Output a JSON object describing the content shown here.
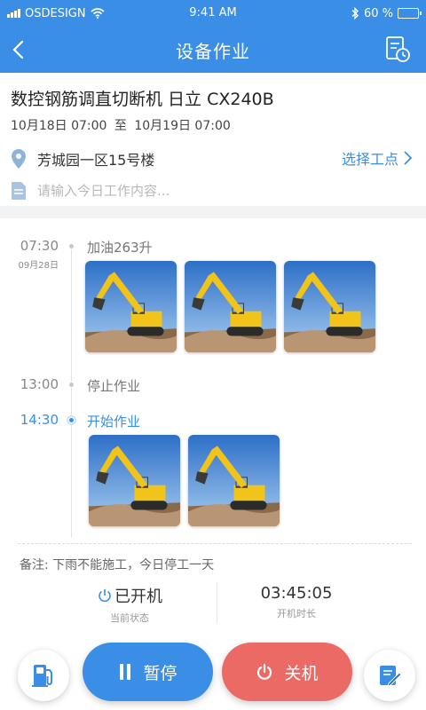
{
  "status_bar": {
    "carrier": "OSDESIGN",
    "time": "9:41 AM",
    "battery": "60 %",
    "battery_level": 0.6,
    "signal_icon": "signal-bars-icon",
    "wifi_icon": "wifi-icon",
    "bluetooth_icon": "bluetooth-icon"
  },
  "nav": {
    "title": "设备作业",
    "back_icon": "chevron-left-icon",
    "doc_icon": "document-clock-icon"
  },
  "equipment": {
    "name": "数控钢筋调直切断机 日立 CX240B",
    "start": "10月18日 07:00",
    "sep": "至",
    "end": "10月19日 07:00"
  },
  "location": {
    "address": "芳城园一区15号楼",
    "select_label": "选择工点"
  },
  "note_input": {
    "placeholder": "请输入今日工作内容..."
  },
  "timeline": [
    {
      "time": "07:30",
      "date": "09月28日",
      "text": "加油263升",
      "active": false,
      "photos": 3
    },
    {
      "time": "13:00",
      "date": "",
      "text": "停止作业",
      "active": false,
      "photos": 0
    },
    {
      "time": "14:30",
      "date": "",
      "text": "开始作业",
      "active": true,
      "photos": 2
    }
  ],
  "remark": "备注: 下雨不能施工，今日停工一天",
  "status": {
    "state_value": "已开机",
    "state_label": "当前状态",
    "duration_value": "03:45:05",
    "duration_label": "开机时长"
  },
  "actions": {
    "pause_label": "暂停",
    "power_label": "关机",
    "fuel_icon": "fuel-pump-icon",
    "edit_icon": "edit-note-icon"
  },
  "colors": {
    "primary": "#3a8ee6",
    "danger": "#ec6a66"
  }
}
